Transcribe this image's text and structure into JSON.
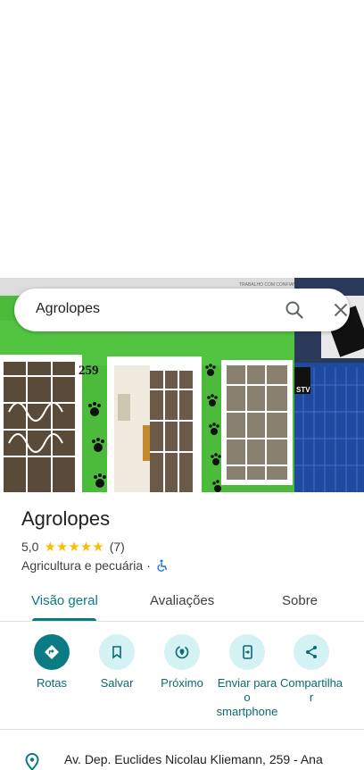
{
  "search": {
    "query": "Agrolopes"
  },
  "hero": {
    "sign_text": "TRABALHO COM CONFIANÇA",
    "number": "259",
    "store_right": "STV"
  },
  "place": {
    "name": "Agrolopes",
    "rating": "5,0",
    "stars": "★★★★★",
    "review_count": "(7)",
    "category": "Agricultura e pecuária",
    "separator": "·"
  },
  "tabs": [
    {
      "label": "Visão geral",
      "active": true
    },
    {
      "label": "Avaliações",
      "active": false
    },
    {
      "label": "Sobre",
      "active": false
    }
  ],
  "actions": [
    {
      "label": "Rotas",
      "icon": "directions-icon"
    },
    {
      "label": "Salvar",
      "icon": "bookmark-icon"
    },
    {
      "label": "Próximo",
      "icon": "nearby-icon"
    },
    {
      "label": "Enviar para o smartphone",
      "icon": "send-to-phone-icon"
    },
    {
      "label": "Compartilhar",
      "icon": "share-icon"
    }
  ],
  "address": {
    "text": "Av. Dep. Euclides Nicolau Kliemann, 259 - Ana"
  },
  "colors": {
    "accent": "#0a7b83",
    "action_bg": "#d4f1f4",
    "star": "#fbbc04",
    "wall_green": "#4fbf3f"
  }
}
